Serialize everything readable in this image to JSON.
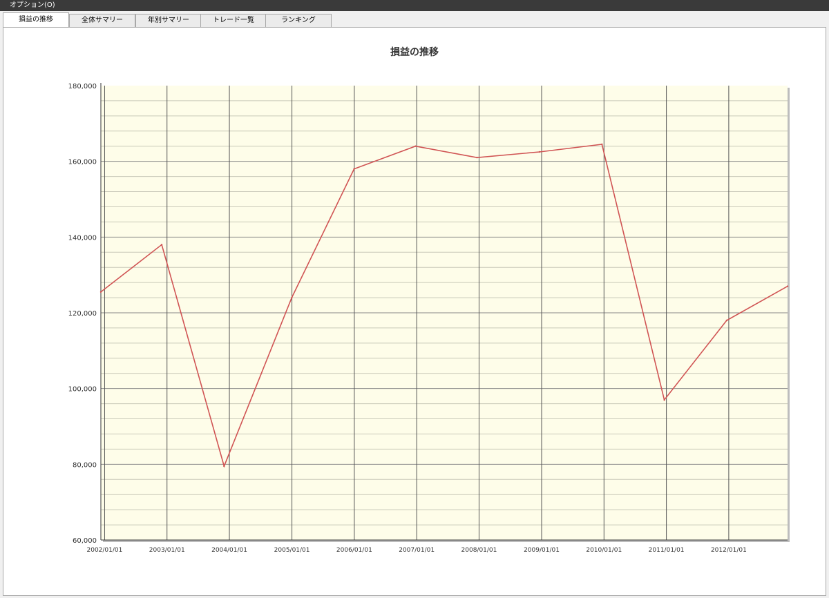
{
  "menu": {
    "options_label": "オプション(O)"
  },
  "tabs": [
    {
      "label": "損益の推移",
      "active": true
    },
    {
      "label": "全体サマリー",
      "active": false
    },
    {
      "label": "年別サマリー",
      "active": false
    },
    {
      "label": "トレード一覧",
      "active": false
    },
    {
      "label": "ランキング",
      "active": false
    }
  ],
  "colors": {
    "plot_background": "#fefde9",
    "series_line": "#d05454",
    "major_grid": "#555555",
    "minor_grid": "#c8c8b8"
  },
  "chart_data": {
    "type": "line",
    "title": "損益の推移",
    "xlabel": "",
    "ylabel": "",
    "ylim": [
      60000,
      180000
    ],
    "xlim": [
      "2001-12-10",
      "2012-12-10"
    ],
    "y_ticks": [
      "180,000",
      "160,000",
      "140,000",
      "120,000",
      "100,000",
      "80,000",
      "60,000"
    ],
    "x_tick_labels": [
      "2002/01/01",
      "2003/01/01",
      "2004/01/01",
      "2005/01/01",
      "2006/01/01",
      "2007/01/01",
      "2008/01/01",
      "2009/01/01",
      "2010/01/01",
      "2011/01/01",
      "2012/01/01"
    ],
    "grid": true,
    "series": [
      {
        "x": [
          "2001-12-10",
          "2002-12-01",
          "2003-12-01",
          "2004-12-31",
          "2005-12-31",
          "2006-12-25",
          "2007-12-20",
          "2008-12-20",
          "2009-12-20",
          "2010-12-20",
          "2011-12-20",
          "2012-12-10"
        ],
        "values": [
          125500,
          138000,
          79500,
          124000,
          158000,
          164000,
          161000,
          162500,
          164500,
          97000,
          118000,
          127000
        ]
      }
    ]
  }
}
